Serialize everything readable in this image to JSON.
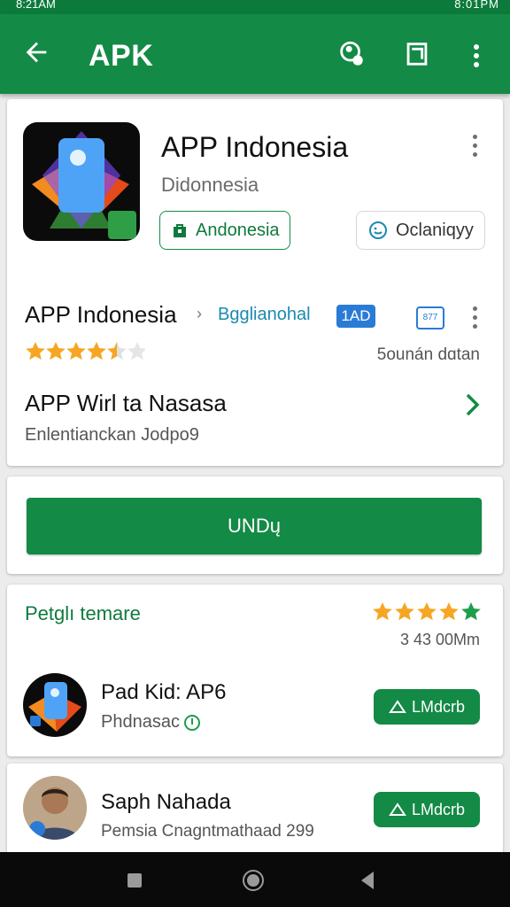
{
  "status_bar": {
    "left_text": "8:21AM",
    "right_text": "8:01PM"
  },
  "app_bar": {
    "title": "APK",
    "icons": [
      "arrow-back-icon",
      "account-icon",
      "share-icon",
      "more-vert-icon"
    ]
  },
  "app": {
    "name": "APP Indonesia",
    "developer": "Didonnesia",
    "chip_primary": "Andonesia",
    "chip_secondary": "Oclaniqyy"
  },
  "details": {
    "name": "APP Indonesia",
    "separator": "›",
    "category": "Bgglianohal",
    "badge": "1AD",
    "calendar_text": "877",
    "rating": 4.5,
    "size_text": "5ounán dɑtan"
  },
  "whats_new": {
    "title": "APP Wirl ta Nasasa",
    "subtitle": "Enlentianckan Jodpo9"
  },
  "install": {
    "label": "UNDų"
  },
  "related": {
    "title": "Petglı temare",
    "rating": 5,
    "count_text": "3 43 00Mm",
    "item": {
      "name": "Pad Kid: AP6",
      "subtitle": "Phdnasac",
      "button": "LMdcrb"
    }
  },
  "person": {
    "name": "Saph Nahada",
    "subtitle": "Pemsia Cnagntmathaad 299",
    "button": "LMdcrb"
  },
  "colors": {
    "primary": "#138a45",
    "accent": "#2a7bd6",
    "star": "#f6a623"
  }
}
